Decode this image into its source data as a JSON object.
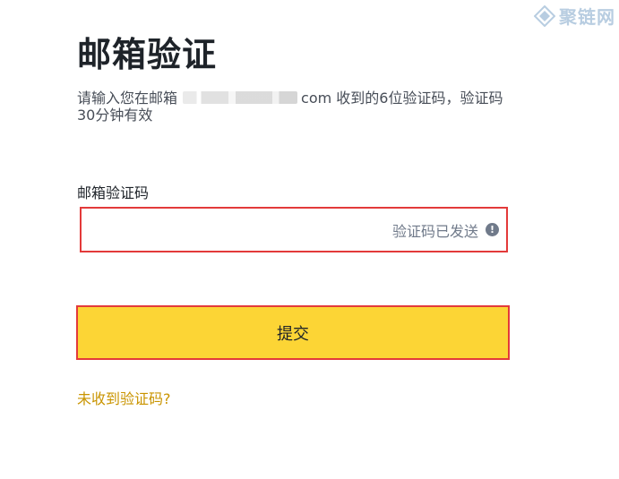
{
  "page": {
    "title": "邮箱验证",
    "description_prefix": "请输入您在邮箱",
    "masked_email_suffix": "com",
    "description_suffix": " 收到的6位验证码，验证码30分钟有效"
  },
  "form": {
    "code_label": "邮箱验证码",
    "code_value": "",
    "sent_status": "验证码已发送",
    "alert_icon_glyph": "!",
    "submit_label": "提交",
    "resend_link": "未收到验证码?"
  },
  "watermark": {
    "text": "聚链网"
  },
  "colors": {
    "accent_button": "#fcd535",
    "highlight_border": "#e33a3a",
    "link": "#c99400",
    "muted_text": "#707a8a"
  },
  "icons": {
    "status": "alert-circle-icon",
    "watermark": "diamond-logo-icon"
  }
}
